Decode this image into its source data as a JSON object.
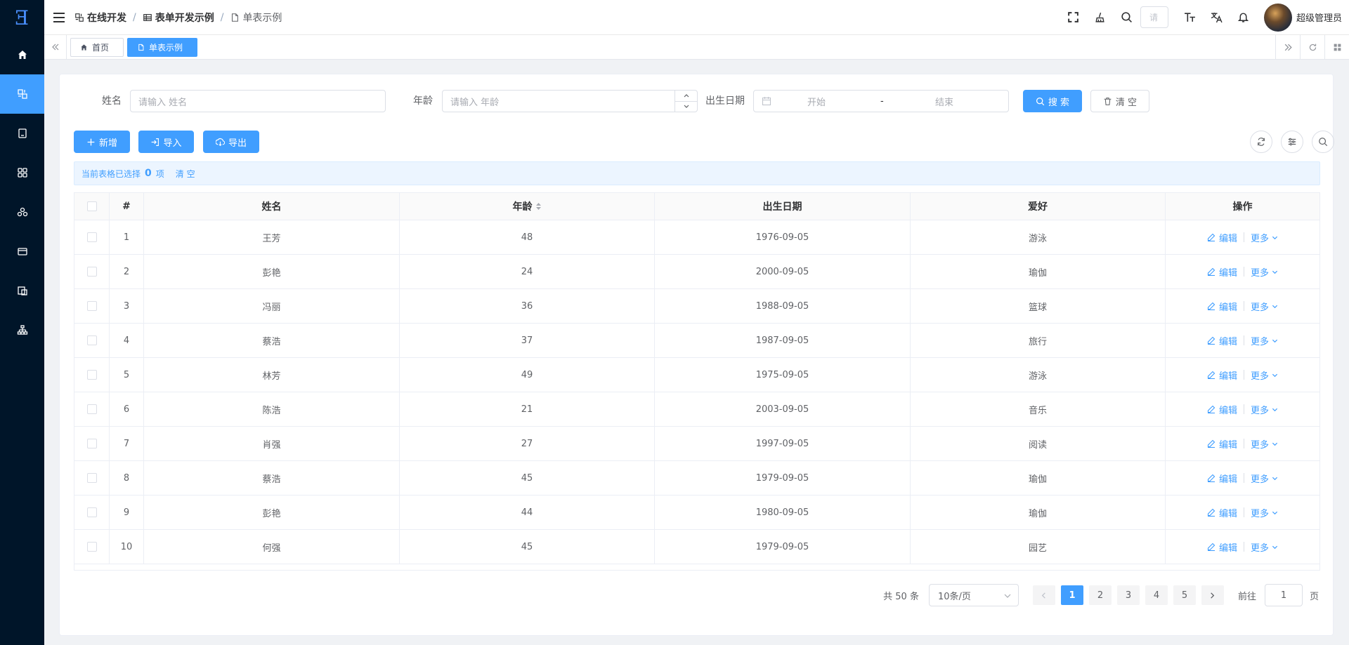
{
  "breadcrumb": [
    "在线开发",
    "表单开发示例",
    "单表示例"
  ],
  "header": {
    "search_placeholder": "请",
    "username": "超级管理员"
  },
  "tabs": [
    {
      "label": "首页",
      "active": false
    },
    {
      "label": "单表示例",
      "active": true
    }
  ],
  "form": {
    "name_label": "姓名",
    "name_placeholder": "请输入 姓名",
    "age_label": "年龄",
    "age_placeholder": "请输入 年龄",
    "birth_label": "出生日期",
    "start_placeholder": "开始",
    "range_sep": "-",
    "end_placeholder": "结束",
    "search_button": "搜 索",
    "reset_button": "清 空"
  },
  "toolbar": {
    "add_button": "新增",
    "import_button": "导入",
    "export_button": "导出"
  },
  "selection": {
    "prefix": "当前表格已选择",
    "count": "0",
    "suffix": "项",
    "clear": "清 空"
  },
  "table": {
    "headers": [
      "#",
      "姓名",
      "年龄",
      "出生日期",
      "爱好",
      "操作"
    ],
    "edit_label": "编辑",
    "more_label": "更多",
    "rows": [
      {
        "idx": "1",
        "name": "王芳",
        "age": "48",
        "birth": "1976-09-05",
        "hobby": "游泳"
      },
      {
        "idx": "2",
        "name": "彭艳",
        "age": "24",
        "birth": "2000-09-05",
        "hobby": "瑜伽"
      },
      {
        "idx": "3",
        "name": "冯丽",
        "age": "36",
        "birth": "1988-09-05",
        "hobby": "篮球"
      },
      {
        "idx": "4",
        "name": "蔡浩",
        "age": "37",
        "birth": "1987-09-05",
        "hobby": "旅行"
      },
      {
        "idx": "5",
        "name": "林芳",
        "age": "49",
        "birth": "1975-09-05",
        "hobby": "游泳"
      },
      {
        "idx": "6",
        "name": "陈浩",
        "age": "21",
        "birth": "2003-09-05",
        "hobby": "音乐"
      },
      {
        "idx": "7",
        "name": "肖强",
        "age": "27",
        "birth": "1997-09-05",
        "hobby": "阅读"
      },
      {
        "idx": "8",
        "name": "蔡浩",
        "age": "45",
        "birth": "1979-09-05",
        "hobby": "瑜伽"
      },
      {
        "idx": "9",
        "name": "彭艳",
        "age": "44",
        "birth": "1980-09-05",
        "hobby": "瑜伽"
      },
      {
        "idx": "10",
        "name": "何强",
        "age": "45",
        "birth": "1979-09-05",
        "hobby": "园艺"
      }
    ]
  },
  "pagination": {
    "total": "共 50 条",
    "page_size": "10条/页",
    "pages": [
      "1",
      "2",
      "3",
      "4",
      "5"
    ],
    "current": "1",
    "goto_label": "前往",
    "goto_value": "1",
    "goto_suffix": "页"
  },
  "colors": {
    "primary": "#409eff",
    "sidebar": "#001529"
  }
}
